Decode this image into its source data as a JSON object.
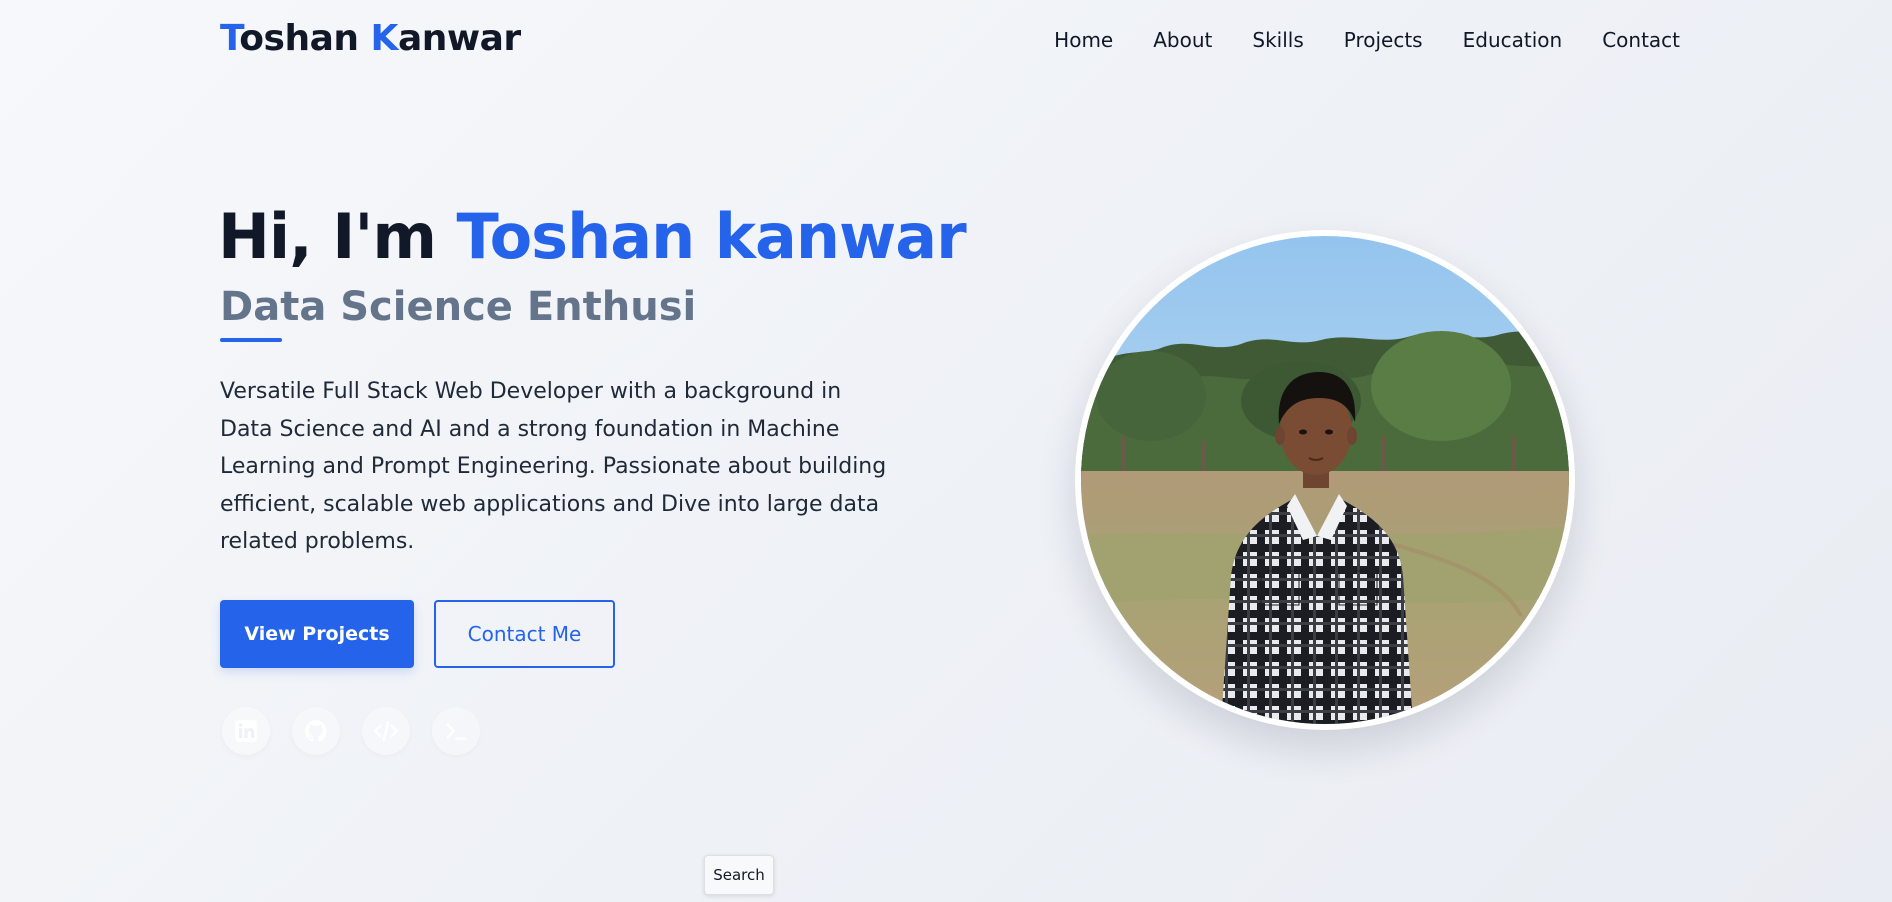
{
  "header": {
    "logo_first_initial": "T",
    "logo_first_rest": "oshan ",
    "logo_last_initial": "K",
    "logo_last_rest": "anwar",
    "nav": [
      {
        "label": "Home"
      },
      {
        "label": "About"
      },
      {
        "label": "Skills"
      },
      {
        "label": "Projects"
      },
      {
        "label": "Education"
      },
      {
        "label": "Contact"
      }
    ]
  },
  "hero": {
    "greeting": "Hi, I'm ",
    "name": "Toshan kanwar",
    "subtitle": "Data Science Enthusi",
    "description": "Versatile Full Stack Web Developer with a background in Data Science and AI and a strong foundation in Machine Learning and Prompt Engineering. Passionate about building efficient, scalable web applications and Dive into large data related problems.",
    "primary_button": "View Projects",
    "secondary_button": "Contact Me",
    "social_icons": [
      "linkedin-icon",
      "github-icon",
      "code-icon",
      "terminal-icon"
    ]
  },
  "search_tooltip": "Search",
  "colors": {
    "accent": "#2563eb",
    "text": "#111827",
    "muted": "#64748b"
  }
}
